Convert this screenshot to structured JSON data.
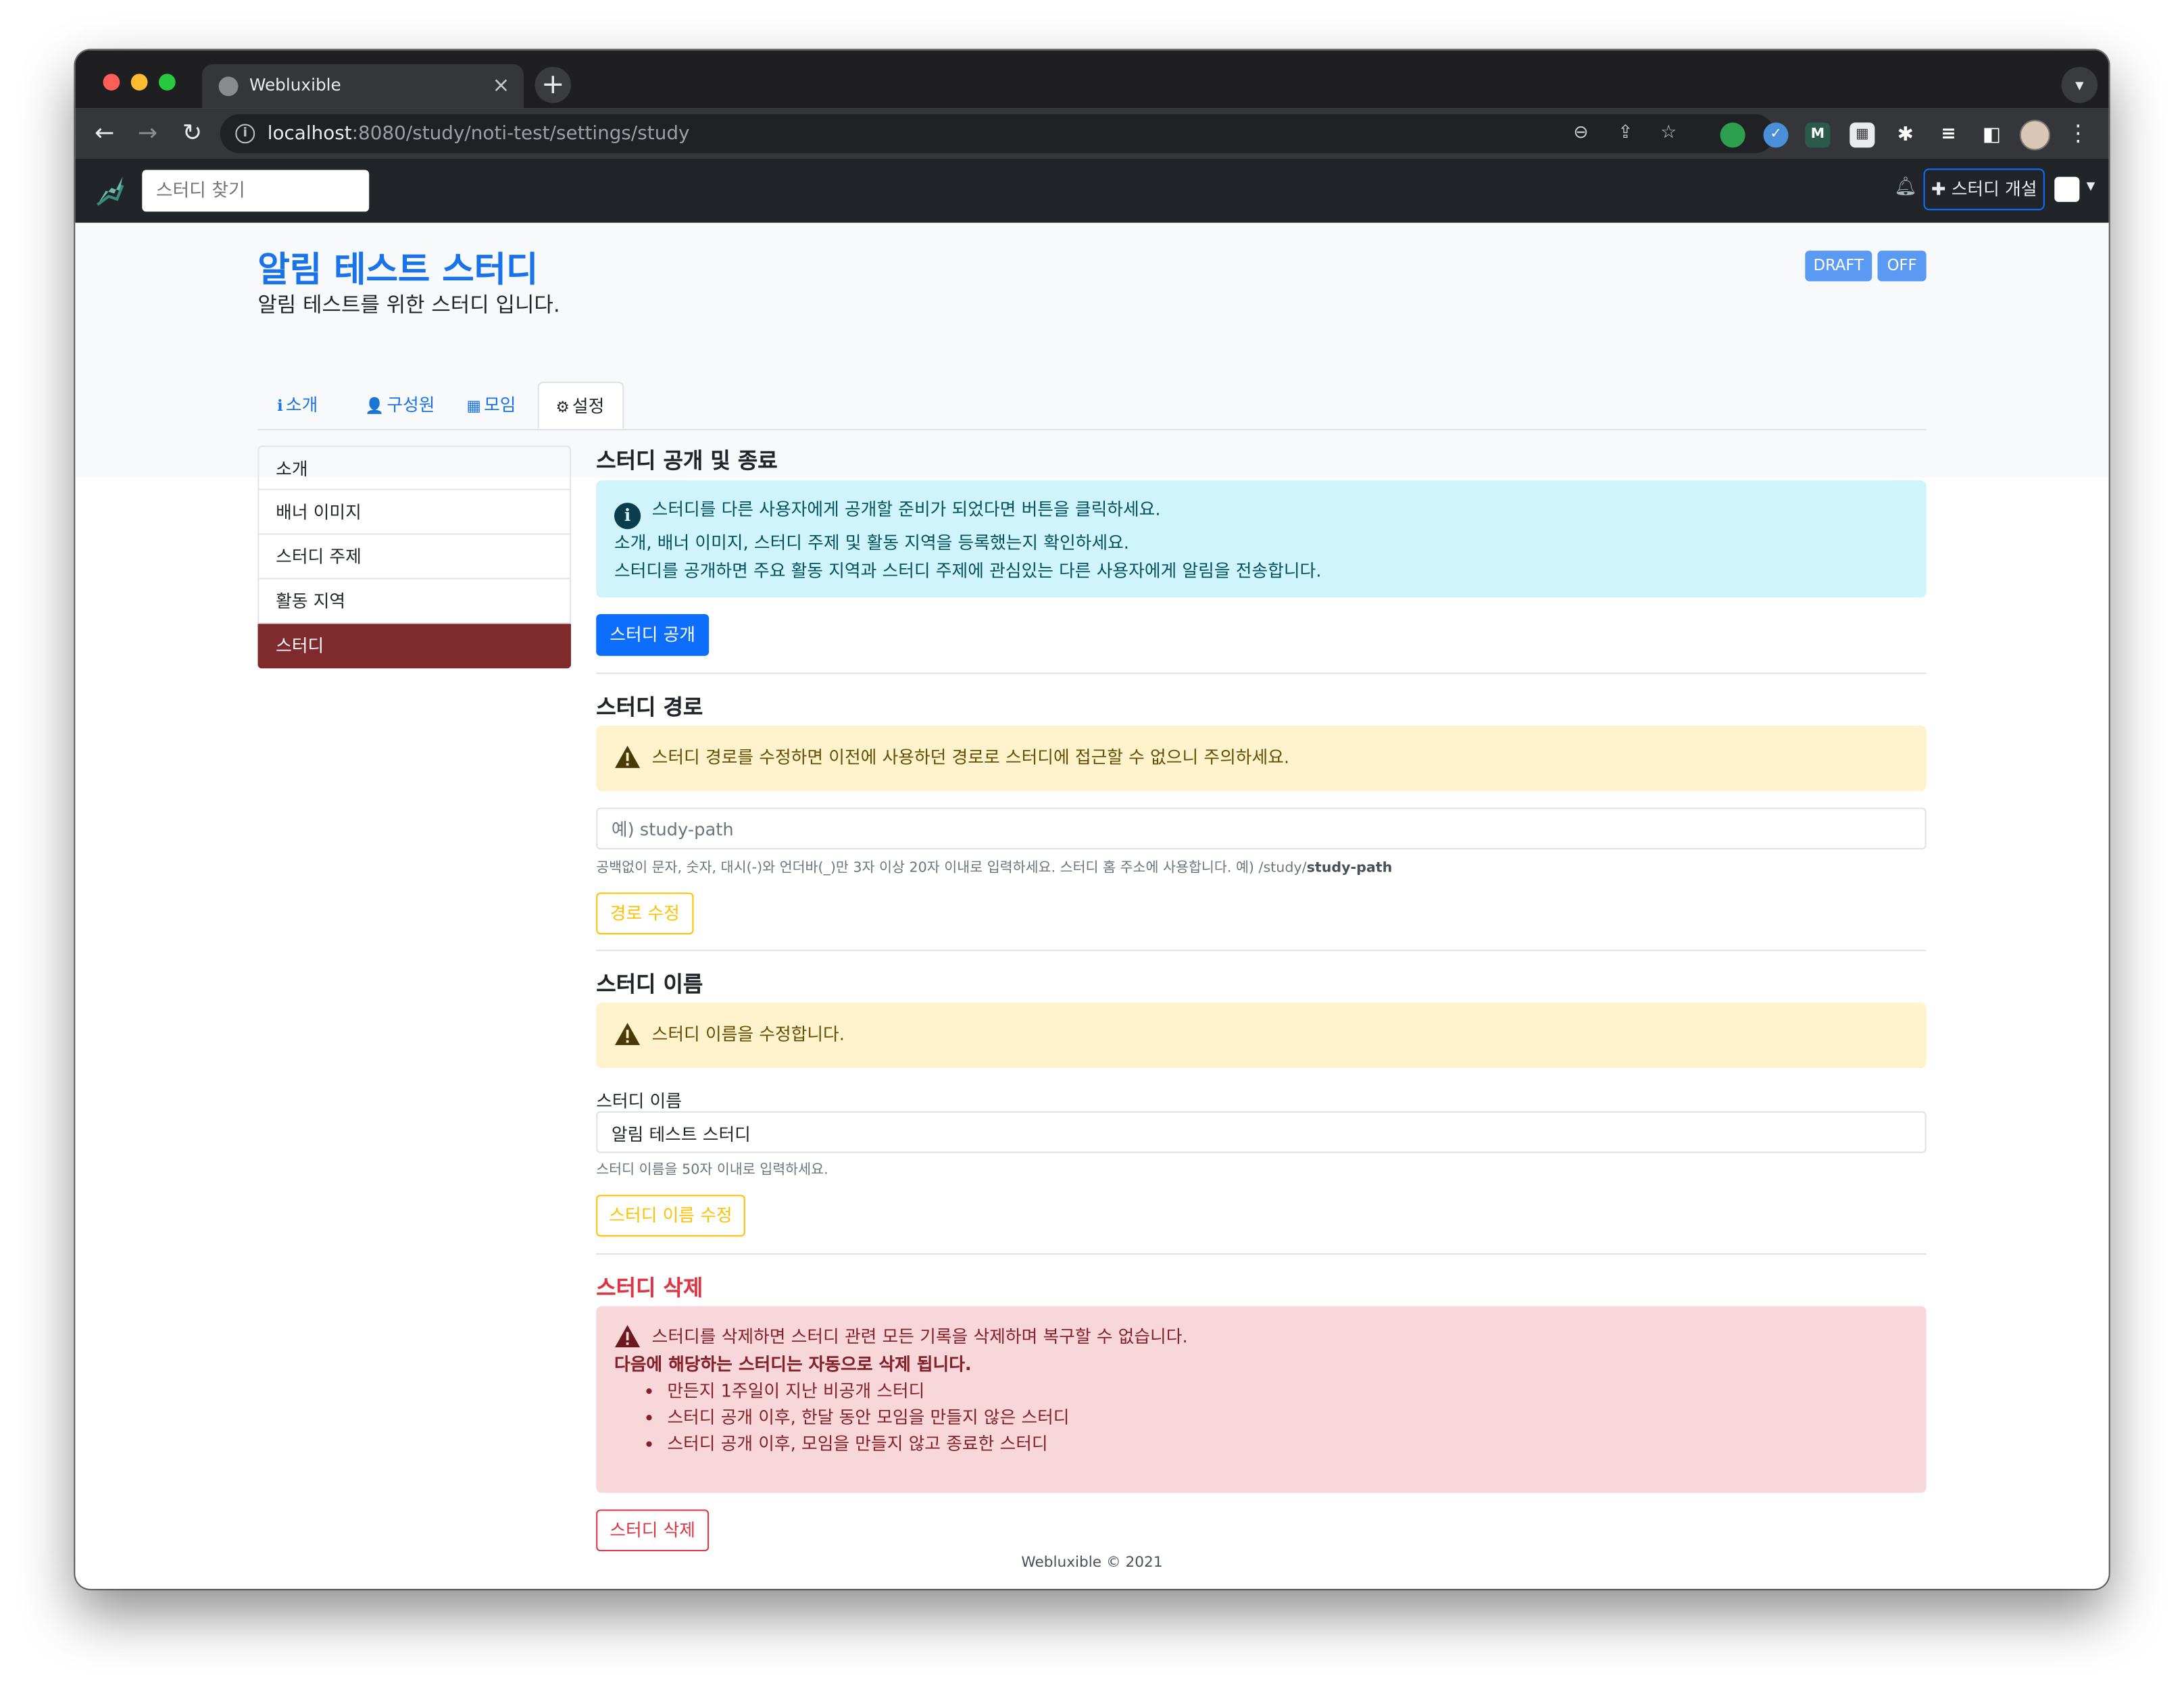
{
  "browser": {
    "tab_title": "Webluxible",
    "url_host": "localhost",
    "url_rest": ":8080/study/noti-test/settings/study",
    "new_tab": "+",
    "tab_close": "×"
  },
  "navbar": {
    "search_placeholder": "스터디 찾기",
    "create_button": "✚ 스터디 개설"
  },
  "study": {
    "title": "알림 테스트 스터디",
    "description": "알림 테스트를 위한 스터디 입니다.",
    "badges": [
      "DRAFT",
      "OFF"
    ]
  },
  "tabs": [
    {
      "label": "소개",
      "icon": "info-circle-icon",
      "glyph": "ℹ"
    },
    {
      "label": "구성원",
      "icon": "user-icon",
      "glyph": "👤"
    },
    {
      "label": "모임",
      "icon": "calendar-icon",
      "glyph": "▦"
    },
    {
      "label": "설정",
      "icon": "gear-icon",
      "glyph": "⚙"
    }
  ],
  "sidebar": {
    "items": [
      {
        "label": "소개"
      },
      {
        "label": "배너 이미지"
      },
      {
        "label": "스터디 주제"
      },
      {
        "label": "활동 지역"
      },
      {
        "label": "스터디"
      }
    ]
  },
  "publish": {
    "heading": "스터디 공개 및 종료",
    "alert_lines": [
      "스터디를 다른 사용자에게 공개할 준비가 되었다면 버튼을 클릭하세요.",
      "소개, 배너 이미지, 스터디 주제 및 활동 지역을 등록했는지 확인하세요.",
      "스터디를 공개하면 주요 활동 지역과 스터디 주제에 관심있는 다른 사용자에게 알림을 전송합니다."
    ],
    "button": "스터디 공개"
  },
  "path": {
    "heading": "스터디 경로",
    "alert": "스터디 경로를 수정하면 이전에 사용하던 경로로 스터디에 접근할 수 없으니 주의하세요.",
    "placeholder": "예) study-path",
    "help_prefix": "공백없이 문자, 숫자, 대시(-)와 언더바(_)만 3자 이상 20자 이내로 입력하세요. 스터디 홈 주소에 사용합니다. 예) /study/",
    "help_bold": "study-path",
    "button": "경로 수정"
  },
  "name": {
    "heading": "스터디 이름",
    "alert": "스터디 이름을 수정합니다.",
    "label": "스터디 이름",
    "value": "알림 테스트 스터디",
    "help": "스터디 이름을 50자 이내로 입력하세요.",
    "button": "스터디 이름 수정"
  },
  "delete": {
    "heading": "스터디 삭제",
    "alert_line": "스터디를 삭제하면 스터디 관련 모든 기록을 삭제하며 복구할 수 없습니다.",
    "alert_bold": "다음에 해당하는 스터디는 자동으로 삭제 됩니다.",
    "bullets": [
      "만든지 1주일이 지난 비공개 스터디",
      "스터디 공개 이후, 한달 동안 모임을 만들지 않은 스터디",
      "스터디 공개 이후, 모임을 만들지 않고 종료한 스터디"
    ],
    "button": "스터디 삭제"
  },
  "footer": "Webluxible © 2021",
  "colors": {
    "primary": "#0d6efd",
    "title_blue": "#1a73e8",
    "sidebar_active": "#7f2a2c",
    "warning": "#ffc107",
    "danger": "#dc3545"
  }
}
